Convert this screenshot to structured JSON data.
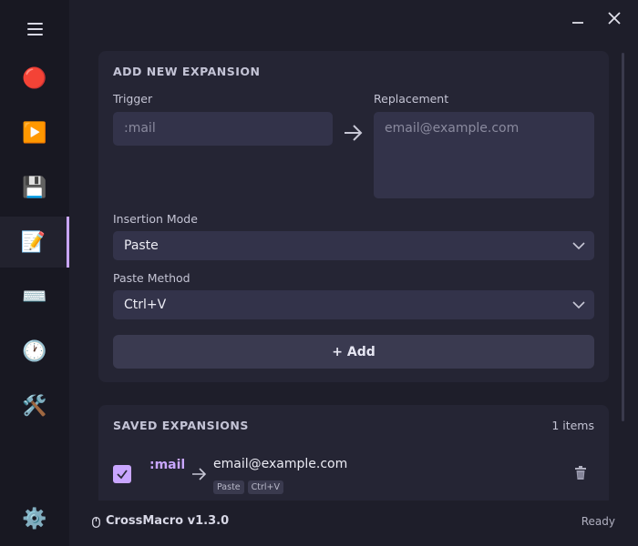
{
  "app": {
    "version_label": "CrossMacro v1.3.0",
    "status": "Ready"
  },
  "window": {
    "minimize_icon": "minimize-icon",
    "close_icon": "close-icon"
  },
  "sidebar": {
    "items": [
      {
        "name": "record",
        "icon": "🔴"
      },
      {
        "name": "play",
        "icon": "▶️"
      },
      {
        "name": "save",
        "icon": "💾"
      },
      {
        "name": "text-expansion",
        "icon": "📝",
        "active": true
      },
      {
        "name": "keyboard",
        "icon": "⌨️"
      },
      {
        "name": "schedule",
        "icon": "🕐"
      },
      {
        "name": "tools",
        "icon": "🛠️"
      }
    ],
    "settings_icon": "⚙️"
  },
  "add_form": {
    "title": "ADD NEW EXPANSION",
    "trigger_label": "Trigger",
    "trigger_placeholder": ":mail",
    "replacement_label": "Replacement",
    "replacement_placeholder": "email@example.com",
    "insertion_mode_label": "Insertion Mode",
    "insertion_mode_value": "Paste",
    "paste_method_label": "Paste Method",
    "paste_method_value": "Ctrl+V",
    "add_button": "+ Add"
  },
  "saved": {
    "title": "SAVED EXPANSIONS",
    "count": "1 items",
    "items": [
      {
        "trigger": ":mail",
        "replacement": "email@example.com",
        "tags": [
          "Paste",
          "Ctrl+V"
        ],
        "enabled": true
      }
    ]
  },
  "colors": {
    "accent": "#c9a6ff",
    "background": "#1e1e2a",
    "card": "#252534",
    "input": "#33334a"
  }
}
